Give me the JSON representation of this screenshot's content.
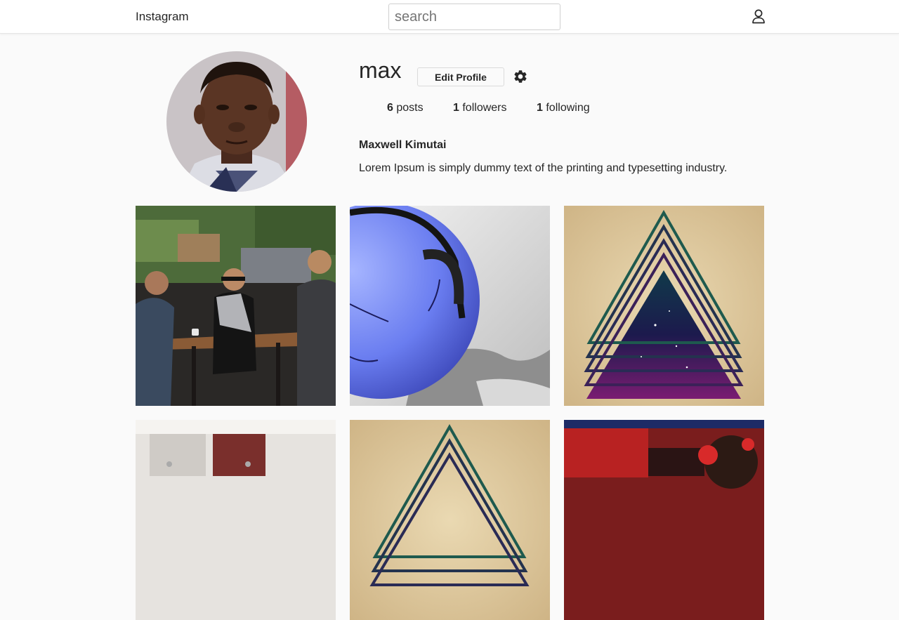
{
  "navbar": {
    "brand": "Instagram",
    "search_placeholder": "search",
    "profile_icon": "user-outline-icon"
  },
  "profile": {
    "username": "max",
    "edit_button_label": "Edit Profile",
    "settings_icon": "gear-icon",
    "stats": {
      "posts_count": "6",
      "posts_label": "posts",
      "followers_count": "1",
      "followers_label": "followers",
      "following_count": "1",
      "following_label": "following"
    },
    "full_name": "Maxwell Kimutai",
    "bio": "Lorem Ipsum is simply dummy text of the printing and typesetting industry."
  },
  "posts": [
    {
      "description": "people-at-cafe-table-photo"
    },
    {
      "description": "blue-ball-with-headphones-render"
    },
    {
      "description": "galaxy-triangle-art"
    },
    {
      "description": "tent-interior-photo"
    },
    {
      "description": "galaxy-triangle-art"
    },
    {
      "description": "person-with-headphones-photo"
    }
  ],
  "colors": {
    "background": "#fafafa",
    "text": "#262626",
    "border": "#dbdbdb"
  }
}
